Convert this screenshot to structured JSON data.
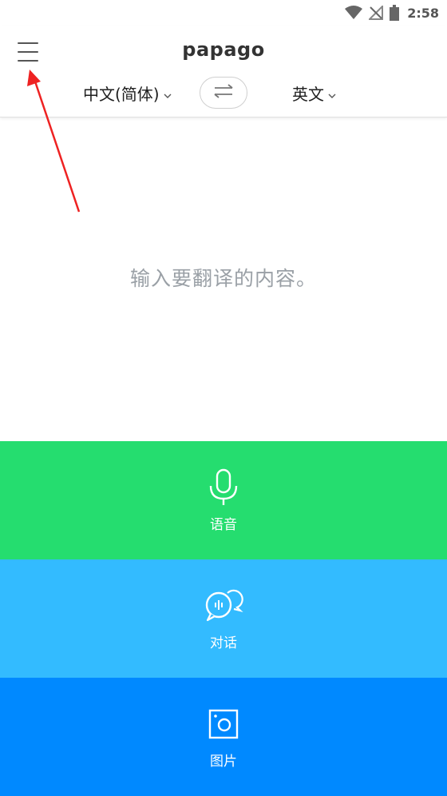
{
  "status_bar": {
    "time": "2:58",
    "icons": [
      "wifi-icon",
      "no-signal-icon",
      "battery-icon"
    ]
  },
  "header": {
    "logo": "papago",
    "menu_icon": "hamburger-menu-icon"
  },
  "languages": {
    "source": "中文(简体)",
    "target": "英文",
    "swap_icon": "swap-arrows-icon"
  },
  "input": {
    "placeholder": "输入要翻译的内容。"
  },
  "modes": [
    {
      "label": "语音",
      "icon": "microphone-icon",
      "color": "#25dd6f"
    },
    {
      "label": "对话",
      "icon": "conversation-bubbles-icon",
      "color": "#33bbff"
    },
    {
      "label": "图片",
      "icon": "image-camera-icon",
      "color": "#0089ff"
    }
  ],
  "annotation": {
    "arrow_color": "#ee2222"
  }
}
